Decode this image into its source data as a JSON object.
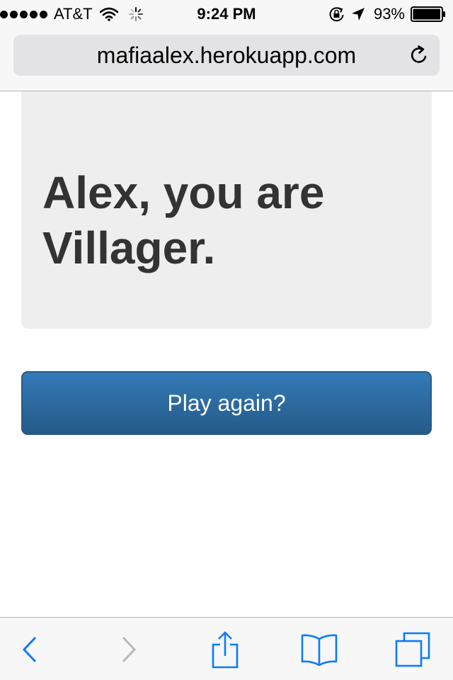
{
  "status_bar": {
    "carrier": "AT&T",
    "time": "9:24 PM",
    "battery_percent": "93%",
    "signal_bars": 5,
    "icons": [
      "wifi-icon",
      "activity-spinner-icon",
      "rotation-lock-icon",
      "location-arrow-icon",
      "battery-icon"
    ]
  },
  "browser": {
    "url": "mafiaalex.herokuapp.com",
    "reload_icon": "reload-icon",
    "accent_color": "#0a7aff"
  },
  "page": {
    "role_message": "Alex, you are Villager.",
    "play_again_label": "Play again?",
    "button_color": "#337ab7"
  },
  "toolbar": {
    "items": [
      {
        "name": "back",
        "icon": "chevron-left-icon",
        "enabled": true
      },
      {
        "name": "forward",
        "icon": "chevron-right-icon",
        "enabled": false
      },
      {
        "name": "share",
        "icon": "share-icon",
        "enabled": true
      },
      {
        "name": "bookmarks",
        "icon": "book-icon",
        "enabled": true
      },
      {
        "name": "tabs",
        "icon": "tabs-icon",
        "enabled": true
      }
    ]
  }
}
